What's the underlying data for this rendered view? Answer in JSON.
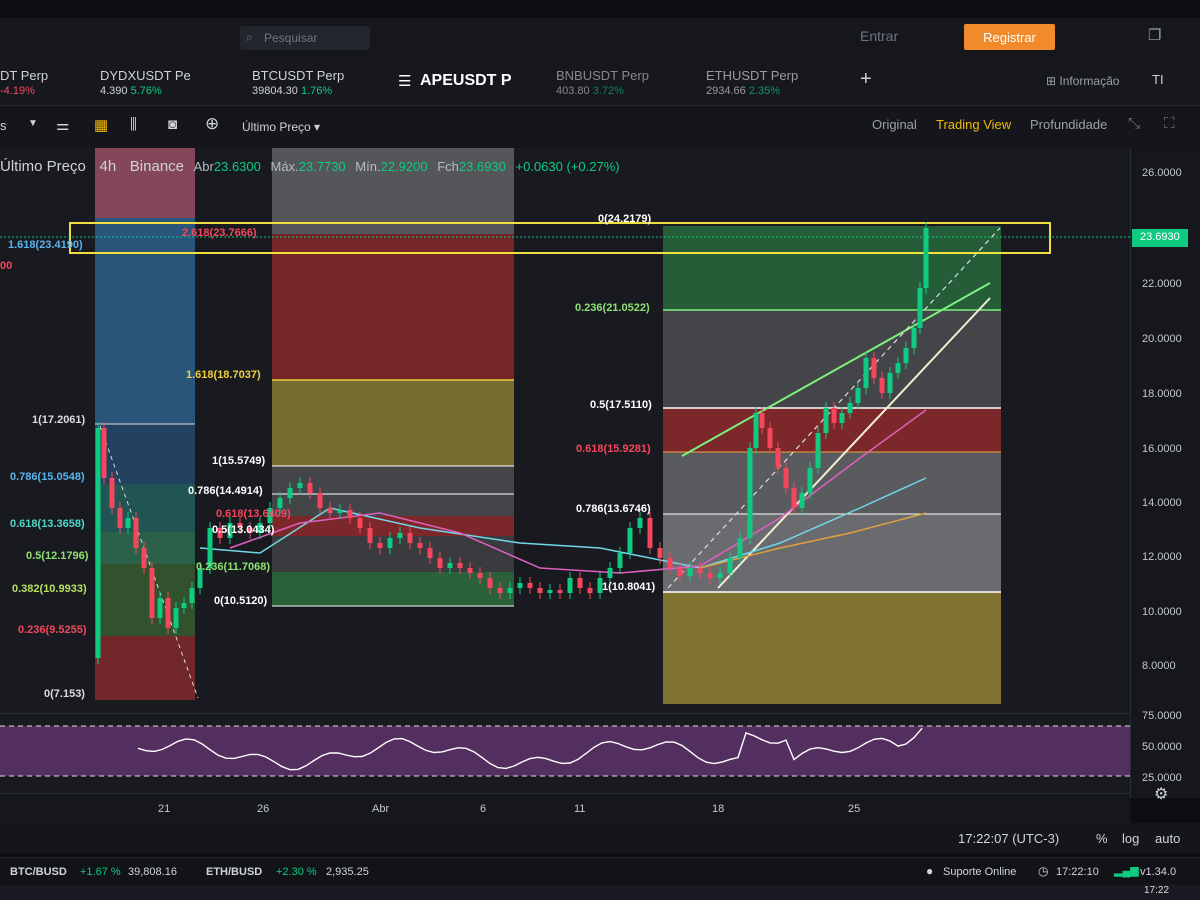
{
  "topbar": {
    "search_placeholder": "Pesquisar",
    "login_label": "Entrar",
    "register_label": "Registrar"
  },
  "pairs": [
    {
      "symbol": "DT Perp",
      "change": "-4.19%",
      "price": ""
    },
    {
      "symbol": "DYDXUSDT Pe",
      "price": "4.390",
      "change": "5.76%"
    },
    {
      "symbol": "BTCUSDT Perp",
      "price": "39804.30",
      "change": "1.76%"
    },
    {
      "symbol": "APEUSDT P",
      "price": "",
      "change": ""
    },
    {
      "symbol": "BNBUSDT Perp",
      "price": "403.80",
      "change": "3.72%"
    },
    {
      "symbol": "ETHUSDT Perp",
      "price": "2934.66",
      "change": "2.35%"
    }
  ],
  "header_right": {
    "info_label": "Informação",
    "ti_label": "TI"
  },
  "toolbar": {
    "price_type": "Último Preço",
    "views": [
      "Original",
      "Trading View",
      "Profundidade"
    ],
    "active_view": "Trading View"
  },
  "ohlc": {
    "price_type": "Último Preço",
    "interval": "4h",
    "exchange": "Binance",
    "open_label": "Abr",
    "open": "23.6300",
    "high_label": "Máx.",
    "high": "23.7730",
    "low_label": "Mín.",
    "low": "22.9200",
    "close_label": "Fch",
    "close": "23.6930",
    "change": "+0.0630 (+0.27%)"
  },
  "price_axis": {
    "ticks": [
      "26.0000",
      "22.0000",
      "20.0000",
      "18.0000",
      "16.0000",
      "14.0000",
      "12.0000",
      "10.0000",
      "8.0000"
    ],
    "current": "23.6930"
  },
  "rsi_axis": [
    "75.0000",
    "50.0000",
    "25.0000"
  ],
  "time_axis": [
    "21",
    "26",
    "Abr",
    "6",
    "11",
    "18",
    "25"
  ],
  "fib_labels": {
    "f1": [
      "1.618(23.4190)",
      "00",
      "1(17.2061)",
      "0.786(15.0548)",
      "0.618(13.3658)",
      "0.5(12.1796)",
      "0.382(10.9933)",
      "0.236(9.5255)",
      "0(7.153)"
    ],
    "f2": [
      "2.618(23.7666)",
      "1.618(18.7037)",
      "1(15.5749)",
      "0.786(14.4914)",
      "0.618(13.6409)",
      "0.5(13.0434)",
      "0.236(11.7068)",
      "0(10.5120)"
    ],
    "f3": [
      "0(24.2179)",
      "0.236(21.0522)",
      "0.5(17.5110)",
      "0.618(15.9281)",
      "0.786(13.6746)",
      "1(10.8041)"
    ]
  },
  "footer": {
    "clock": "17:22:07 (UTC-3)",
    "pct": "%",
    "log": "log",
    "auto": "auto"
  },
  "statusbar": {
    "t1_symbol": "BTC/BUSD",
    "t1_change": "+1.67 %",
    "t1_price": "39,808.16",
    "t2_symbol": "ETH/BUSD",
    "t2_change": "+2.30 %",
    "t2_price": "2,935.25",
    "support": "Suporte Online",
    "time": "17:22:10",
    "version": "v1.34.0"
  },
  "taskbar": {
    "time": "17:22"
  },
  "colors": {
    "accent": "#f0b90b",
    "up": "#0ecb81",
    "down": "#f6465d",
    "register": "#f08a2b"
  }
}
